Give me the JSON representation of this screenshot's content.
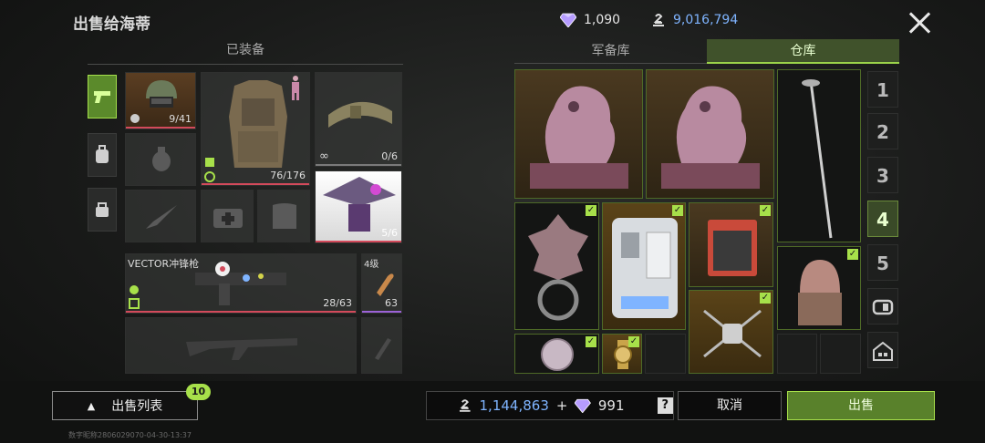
{
  "header": {
    "title": "出售给海蒂",
    "diamonds": "1,090",
    "coins": "9,016,794"
  },
  "equipped": {
    "section_title": "已装备",
    "helmet_durability": "9/41",
    "armor_durability": "76/176",
    "belt_durability": "0/6",
    "hat_durability": "5/6",
    "weapon_name": "VECTOR冲锋枪",
    "weapon_ammo": "28/63",
    "ammo_level": "4级",
    "ammo_count": "63"
  },
  "tabs": [
    {
      "label": "军备库",
      "active": false
    },
    {
      "label": "仓库",
      "active": true
    }
  ],
  "pages": [
    "1",
    "2",
    "3",
    "4",
    "5"
  ],
  "active_page": "4",
  "inventory_icons": [
    "qilin-statue",
    "qilin-statue",
    "sword",
    "dragon-door-knocker",
    "power-station",
    "jerry-can",
    "jade-seal",
    "coin",
    "gold-watch",
    "drone"
  ],
  "bottom": {
    "sell_list_label": "出售列表",
    "sell_list_count": "10",
    "total_coins": "1,144,863",
    "plus": "+",
    "total_diamonds": "991",
    "help": "?",
    "cancel_label": "取消",
    "sell_label": "出售",
    "footer": "数字昵称2806029070-04-30-13:37"
  },
  "colors": {
    "accent_green": "#a7e04a",
    "coin_blue": "#7fb4ff",
    "durability_red": "#d34a5b"
  }
}
